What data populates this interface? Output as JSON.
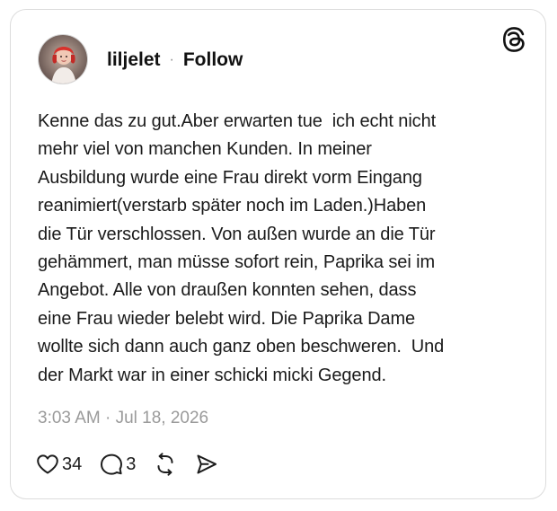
{
  "post": {
    "author": {
      "username": "liljelet",
      "separator": "·",
      "follow_label": "Follow",
      "avatar_icon": "profile-avatar"
    },
    "brand_icon": "threads-logo-icon",
    "text_lines": [
      "Kenne das zu gut.Aber erwarten tue  ich echt nicht",
      "mehr viel von manchen Kunden. In meiner",
      "Ausbildung wurde eine Frau direkt vorm Eingang",
      "reanimiert(verstarb später noch im Laden.)Haben",
      "die Tür verschlossen. Von außen wurde an die Tür",
      "gehämmert, man müsse sofort rein, Paprika sei im",
      "Angebot. Alle von draußen konnten sehen, dass",
      "eine Frau wieder belebt wird. Die Paprika Dame",
      "wollte sich dann auch ganz oben beschweren.  Und",
      "der Markt war in einer schicki micki Gegend."
    ],
    "timestamp": "3:03 AM · Jul 18, 2026",
    "actions": {
      "like": {
        "icon": "heart-icon",
        "count": "34"
      },
      "reply": {
        "icon": "speech-bubble-icon",
        "count": "3"
      },
      "repost": {
        "icon": "repost-icon"
      },
      "share": {
        "icon": "send-icon"
      }
    }
  },
  "colors": {
    "text": "#1a1a1a",
    "muted": "#9a9a9a",
    "border": "#dcdcdc",
    "background": "#ffffff"
  }
}
